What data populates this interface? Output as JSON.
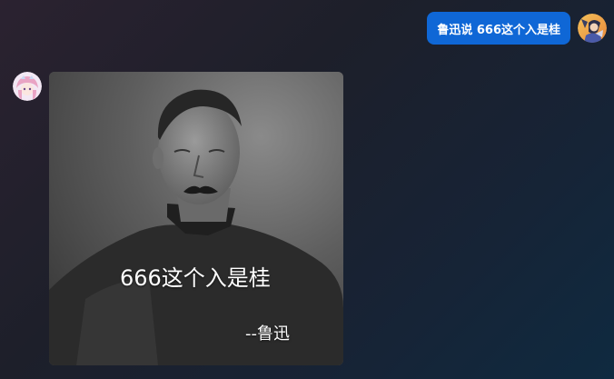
{
  "chat": {
    "outgoing": {
      "text": "鲁迅说 666这个入是桂",
      "bubble_color": "#0f67d6",
      "avatar_icon": "user-avatar-icon"
    },
    "incoming": {
      "avatar_icon": "bot-avatar-icon",
      "image": {
        "caption": "666这个入是桂",
        "attribution": "--鲁迅"
      }
    }
  }
}
